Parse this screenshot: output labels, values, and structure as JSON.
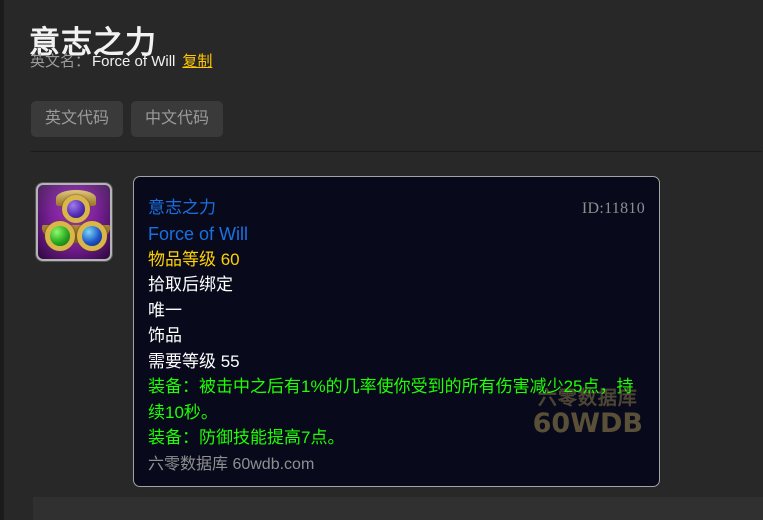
{
  "header": {
    "title": "意志之力",
    "english_name_label": "英文名：",
    "english_name_value": "Force of Will",
    "copy_link": "复制"
  },
  "buttons": {
    "english_code": "英文代码",
    "chinese_code": "中文代码"
  },
  "item_icon": {
    "name": "trinket-icon-force-of-will",
    "background_color": "#7b1f99",
    "gem_colors": [
      "#5530b8",
      "#28a820",
      "#1f56c8"
    ],
    "frame_color": "#b4b4b4"
  },
  "tooltip": {
    "name_cn": "意志之力",
    "name_en": "Force of Will",
    "id_label": "ID:11810",
    "item_level": "物品等级 60",
    "bind": "拾取后绑定",
    "unique": "唯一",
    "slot": "饰品",
    "required_level": "需要等级 55",
    "effects": [
      "装备：被击中之后有1%的几率使你受到的所有伤害减少25点，持续10秒。",
      "装备：防御技能提高7点。"
    ],
    "footer": "六零数据库 60wdb.com",
    "colors": {
      "quality_blue": "#1a70e0",
      "item_level_yellow": "#ffd100",
      "effect_green": "#1eff00",
      "background": "#080a1c",
      "border": "#a3a3a3"
    }
  },
  "watermark": {
    "line1": "六零数据库",
    "line2": "60WDB"
  }
}
